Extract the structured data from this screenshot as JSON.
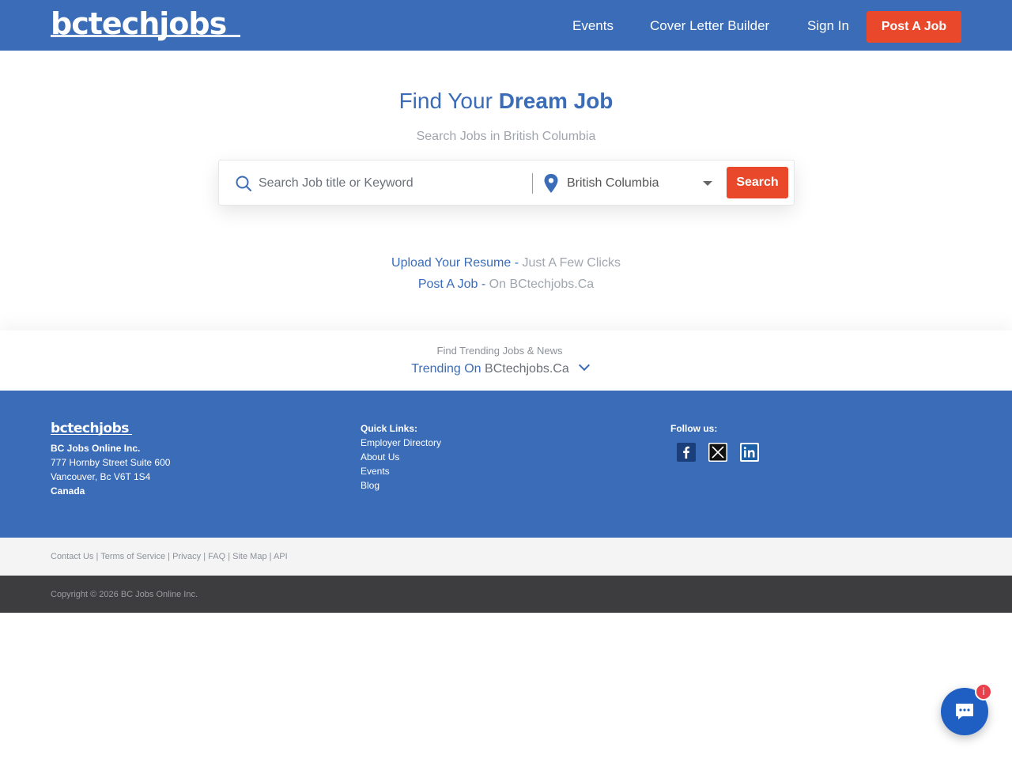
{
  "header": {
    "logo_text": "bctechjobs",
    "nav": {
      "events": "Events",
      "cover_letter": "Cover Letter Builder",
      "sign_in": "Sign In"
    },
    "post_job_label": "Post A Job"
  },
  "hero": {
    "title_plain": "Find Your ",
    "title_bold": "Dream Job",
    "subtitle": "Search Jobs in British Columbia",
    "search": {
      "placeholder": "Search Job title or Keyword",
      "location_value": "British Columbia",
      "button_label": "Search"
    },
    "cta": {
      "resume_link": "Upload Your Resume -",
      "resume_muted": "Just A Few Clicks",
      "post_link": "Post A Job -",
      "post_muted": "On BCtechjobs.Ca"
    }
  },
  "trending": {
    "small": "Find Trending Jobs & News",
    "main_a": "Trending On ",
    "main_b": "BCtechjobs.Ca"
  },
  "footer": {
    "logo_text": "bctechjobs",
    "company": "BC Jobs Online Inc.",
    "address1": "777 Hornby Street Suite 600",
    "address2": "Vancouver, Bc V6T 1S4",
    "country": "Canada",
    "quick_links_title": "Quick Links:",
    "quick_links": [
      "Employer Directory",
      "About Us",
      "Events",
      "Blog"
    ],
    "follow_title": "Follow us:",
    "social_icons": [
      "facebook-icon",
      "x-icon",
      "linkedin-icon"
    ]
  },
  "legal": {
    "contact": "Contact Us",
    "terms": "Terms of Service",
    "privacy": "Privacy",
    "faq": "FAQ",
    "sitemap": "Site Map",
    "api": "API",
    "separator": " | "
  },
  "copyright": "Copyright © 2026 BC Jobs Online Inc.",
  "chat": {
    "badge": "i"
  },
  "colors": {
    "brand_blue": "#3b6cb7",
    "accent_orange": "#e9492a",
    "dark_bar": "#3d3d3f",
    "chat_blue": "#1f5fc4",
    "badge_red": "#e8414b"
  }
}
